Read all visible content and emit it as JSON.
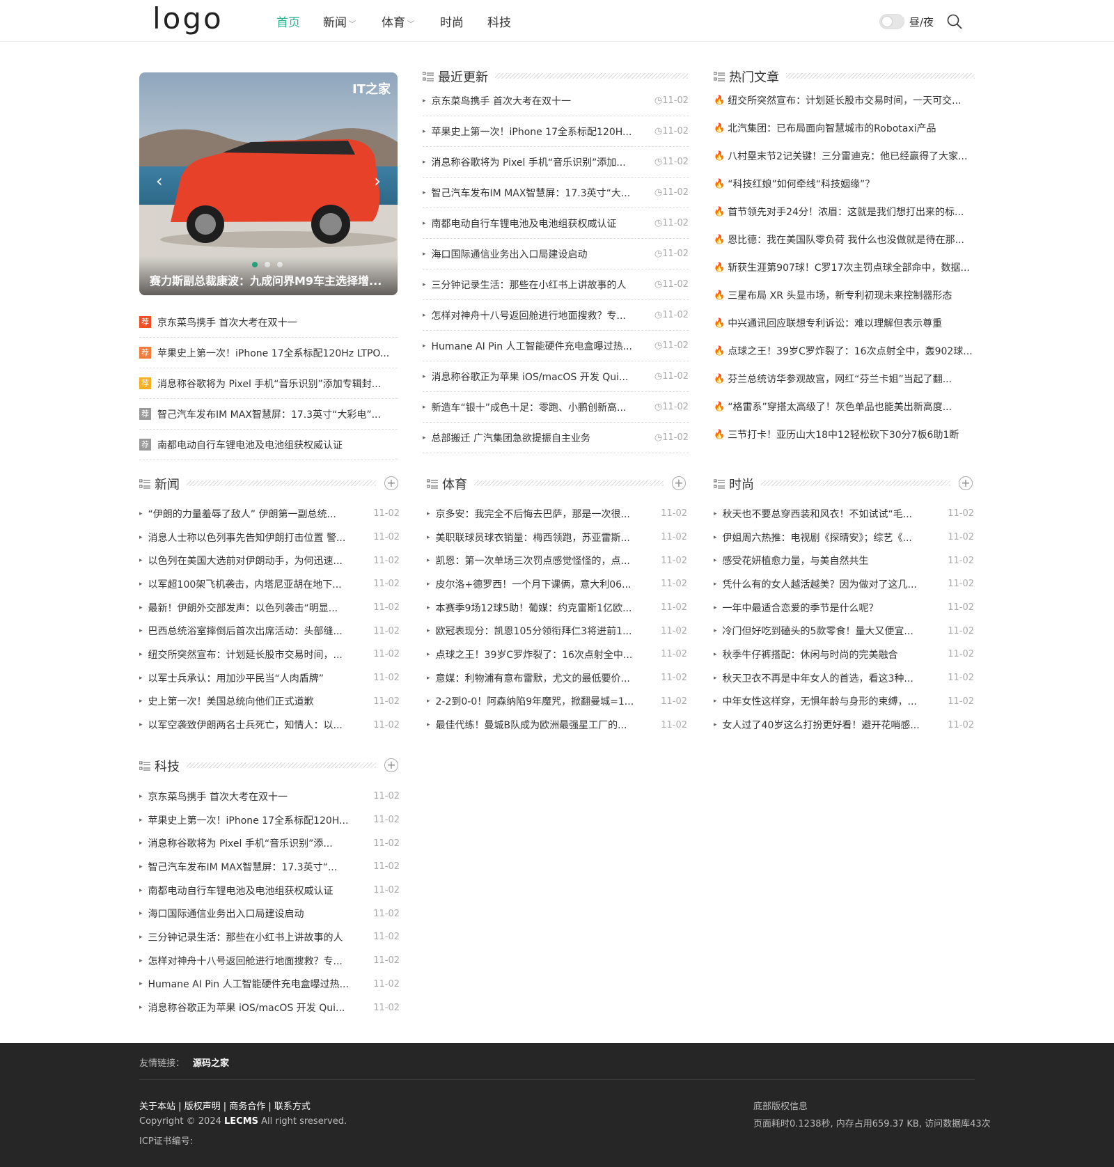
{
  "header": {
    "logo": "logo",
    "nav": [
      {
        "label": "首页",
        "active": true,
        "dropdown": false
      },
      {
        "label": "新闻",
        "active": false,
        "dropdown": true
      },
      {
        "label": "体育",
        "active": false,
        "dropdown": true
      },
      {
        "label": "时尚",
        "active": false,
        "dropdown": false
      },
      {
        "label": "科技",
        "active": false,
        "dropdown": false
      }
    ],
    "day_night": "昼/夜",
    "accent": "#2bb38d"
  },
  "slider": {
    "caption": "赛力斯副总裁康波：九成问界M9车主选择增...",
    "watermark": "IT之家",
    "dots_total": 3,
    "active_dot": 1
  },
  "recommend": {
    "badge": "荐",
    "items": [
      {
        "title": "京东菜鸟携手 首次大考在双十一",
        "color": "#f04e23"
      },
      {
        "title": "苹果史上第一次！iPhone 17全系标配120Hz LTPO...",
        "color": "#f47a3a"
      },
      {
        "title": "消息称谷歌将为 Pixel 手机“音乐识别”添加专辑封...",
        "color": "#f5b021"
      },
      {
        "title": "智己汽车发布IM MAX智慧屏：17.3英寸“大彩电”...",
        "color": "#999999"
      },
      {
        "title": "南都电动自行车锂电池及电池组获权威认证",
        "color": "#999999"
      }
    ]
  },
  "recent": {
    "title": "最近更新",
    "items": [
      {
        "title": "京东菜鸟携手 首次大考在双十一",
        "date": "11-02"
      },
      {
        "title": "苹果史上第一次！iPhone 17全系标配120H...",
        "date": "11-02"
      },
      {
        "title": "消息称谷歌将为 Pixel 手机“音乐识别”添加...",
        "date": "11-02"
      },
      {
        "title": "智己汽车发布IM MAX智慧屏：17.3英寸“大...",
        "date": "11-02"
      },
      {
        "title": "南都电动自行车锂电池及电池组获权威认证",
        "date": "11-02"
      },
      {
        "title": "海口国际通信业务出入口局建设启动",
        "date": "11-02"
      },
      {
        "title": "三分钟记录生活：那些在小红书上讲故事的人",
        "date": "11-02"
      },
      {
        "title": "怎样对神舟十八号返回舱进行地面搜救？专...",
        "date": "11-02"
      },
      {
        "title": "Humane AI Pin 人工智能硬件充电盒曝过热...",
        "date": "11-02"
      },
      {
        "title": "消息称谷歌正为苹果 iOS/macOS 开发 Qui...",
        "date": "11-02"
      },
      {
        "title": "新造车“银十”成色十足：零跑、小鹏创新高...",
        "date": "11-02"
      },
      {
        "title": "总部搬迁 广汽集团急欲提振自主业务",
        "date": "11-02"
      }
    ]
  },
  "hot": {
    "title": "热门文章",
    "items": [
      "纽交所突然宣布：计划延长股市交易时间，一天可交...",
      "北汽集团：已布局面向智慧城市的Robotaxi产品",
      "八村塁末节2记关键！三分雷迪克：他已经赢得了大家...",
      "“科技红娘”如何牵线“科技姻缘”？",
      "首节领先对手24分！浓眉：这就是我们想打出来的标...",
      "恩比德：我在美国队零负荷 我什么也没做就是待在那...",
      "斩获生涯第907球！C罗17次主罚点球全部命中，数据...",
      "三星布局 XR 头显市场，新专利初现未来控制器形态",
      "中兴通讯回应联想专利诉讼：难以理解但表示尊重",
      "点球之王！39岁C罗炸裂了：16次点射全中，轰902球...",
      "芬兰总统访华参观故宫，网红“芬兰卡姐”当起了翻...",
      "“格雷系”穿搭太高级了！灰色单品也能美出新高度...",
      "三节打卡！亚历山大18中12轻松砍下30分7板6助1断"
    ]
  },
  "news": {
    "title": "新闻",
    "items": [
      {
        "title": "“伊朗的力量羞辱了敌人” 伊朗第一副总统...",
        "date": "11-02"
      },
      {
        "title": "消息人士称以色列事先告知伊朗打击位置 警...",
        "date": "11-02"
      },
      {
        "title": "以色列在美国大选前对伊朗动手，为何迅速...",
        "date": "11-02"
      },
      {
        "title": "以军超100架飞机袭击，内塔尼亚胡在地下...",
        "date": "11-02"
      },
      {
        "title": "最新！伊朗外交部发声：以色列袭击“明显...",
        "date": "11-02"
      },
      {
        "title": "巴西总统浴室摔倒后首次出席活动：头部缝...",
        "date": "11-02"
      },
      {
        "title": "纽交所突然宣布：计划延长股市交易时间，...",
        "date": "11-02"
      },
      {
        "title": "以军士兵承认：用加沙平民当“人肉盾牌”",
        "date": "11-02"
      },
      {
        "title": "史上第一次！美国总统向他们正式道歉",
        "date": "11-02"
      },
      {
        "title": "以军空袭致伊朗两名士兵死亡，知情人：以...",
        "date": "11-02"
      }
    ]
  },
  "sports": {
    "title": "体育",
    "items": [
      {
        "title": "京多安：我完全不后悔去巴萨，那是一次很...",
        "date": "11-02"
      },
      {
        "title": "美职联球员球衣销量：梅西领跑，苏亚雷斯...",
        "date": "11-02"
      },
      {
        "title": "凯恩：第一次单场三次罚点感觉怪怪的，点...",
        "date": "11-02"
      },
      {
        "title": "皮尔洛+德罗西！一个月下课俩，意大利06...",
        "date": "11-02"
      },
      {
        "title": "本赛季9场12球5助！葡媒：约克雷斯1亿欧...",
        "date": "11-02"
      },
      {
        "title": "欧冠表现分：凯恩105分领衔拜仁3将进前1...",
        "date": "11-02"
      },
      {
        "title": "点球之王！39岁C罗炸裂了：16次点射全中...",
        "date": "11-02"
      },
      {
        "title": "意媒：利物浦有意布雷默，尤文的最低要价...",
        "date": "11-02"
      },
      {
        "title": "2-2到0-0！阿森纳陷9年魔咒，掀翻曼城=1...",
        "date": "11-02"
      },
      {
        "title": "最佳代练！曼城B队成为欧洲最强星工厂的...",
        "date": "11-02"
      }
    ]
  },
  "fashion": {
    "title": "时尚",
    "items": [
      {
        "title": "秋天也不要总穿西装和风衣！不如试试“毛...",
        "date": "11-02"
      },
      {
        "title": "伊姐周六热推：电视剧《探晴安》；综艺《...",
        "date": "11-02"
      },
      {
        "title": "感受花妍植愈力量，与美自然共生",
        "date": "11-02"
      },
      {
        "title": "凭什么有的女人越活越美？因为做对了这几...",
        "date": "11-02"
      },
      {
        "title": "一年中最适合恋爱的季节是什么呢？",
        "date": "11-02"
      },
      {
        "title": "冷门但好吃到磕头的5款零食！量大又便宜...",
        "date": "11-02"
      },
      {
        "title": "秋季牛仔裤搭配：休闲与时尚的完美融合",
        "date": "11-02"
      },
      {
        "title": "秋天卫衣不再是中年女人的首选，看这3种...",
        "date": "11-02"
      },
      {
        "title": "中年女性这样穿，无惧年龄与身形的束缚，...",
        "date": "11-02"
      },
      {
        "title": "女人过了40岁这么打扮更好看！避开花哨感...",
        "date": "11-02"
      }
    ]
  },
  "tech": {
    "title": "科技",
    "items": [
      {
        "title": "京东菜鸟携手 首次大考在双十一",
        "date": "11-02"
      },
      {
        "title": "苹果史上第一次！iPhone 17全系标配120H...",
        "date": "11-02"
      },
      {
        "title": "消息称谷歌将为 Pixel 手机“音乐识别”添...",
        "date": "11-02"
      },
      {
        "title": "智己汽车发布IM MAX智慧屏：17.3英寸“...",
        "date": "11-02"
      },
      {
        "title": "南都电动自行车锂电池及电池组获权威认证",
        "date": "11-02"
      },
      {
        "title": "海口国际通信业务出入口局建设启动",
        "date": "11-02"
      },
      {
        "title": "三分钟记录生活：那些在小红书上讲故事的人",
        "date": "11-02"
      },
      {
        "title": "怎样对神舟十八号返回舱进行地面搜救？专...",
        "date": "11-02"
      },
      {
        "title": "Humane AI Pin 人工智能硬件充电盒曝过热...",
        "date": "11-02"
      },
      {
        "title": "消息称谷歌正为苹果 iOS/macOS 开发 Qui...",
        "date": "11-02"
      }
    ]
  },
  "footer": {
    "friend_links_label": "友情链接：",
    "friend_link": "源码之家",
    "nav_links": "关于本站 | 版权声明 | 商务合作 | 联系方式",
    "copyright_prefix": "Copyright © 2024 ",
    "brand": "LECMS",
    "copyright_suffix": " All right sreserved.",
    "icp": "ICP证书编号:",
    "right_title": "底部版权信息",
    "stats": "页面耗时0.1238秒, 内存占用659.37 KB, 访问数据库43次"
  }
}
